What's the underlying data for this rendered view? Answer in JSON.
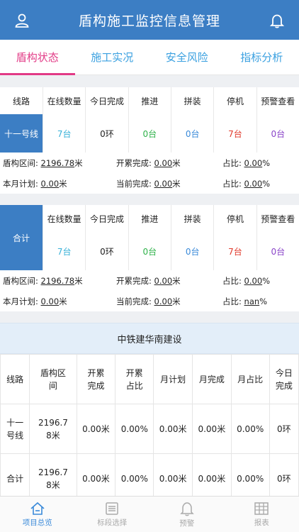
{
  "app": {
    "title": "盾构施工监控信息管理"
  },
  "icons": {
    "user": "user-icon",
    "bell": "bell-icon"
  },
  "tabs": [
    {
      "label": "盾构状态",
      "active": true
    },
    {
      "label": "施工实况",
      "active": false
    },
    {
      "label": "安全风险",
      "active": false
    },
    {
      "label": "指标分析",
      "active": false
    }
  ],
  "line_section": {
    "columns": [
      "线路",
      "在线数量",
      "今日完成",
      "推进",
      "拼装",
      "停机",
      "预警查看"
    ],
    "row_label": "十一号线",
    "values": [
      "7台",
      "0环",
      "0台",
      "0台",
      "7台",
      "0台"
    ],
    "info": {
      "interval_label": "盾构区间:",
      "interval_value": "2196.78",
      "interval_unit": "米",
      "cum_label": "开累完成:",
      "cum_value": "0.00",
      "cum_unit": "米",
      "ratio1_label": "占比:",
      "ratio1_value": "0.00",
      "ratio1_unit": "%",
      "plan_label": "本月计划:",
      "plan_value": "0.00",
      "plan_unit": "米",
      "cur_label": "当前完成:",
      "cur_value": "0.00",
      "cur_unit": "米",
      "ratio2_label": "占比:",
      "ratio2_value": "0.00",
      "ratio2_unit": "%"
    }
  },
  "total_section": {
    "row_label": "合计",
    "columns": [
      "在线数量",
      "今日完成",
      "推进",
      "拼装",
      "停机",
      "预警查看"
    ],
    "values": [
      "7台",
      "0环",
      "0台",
      "0台",
      "7台",
      "0台"
    ],
    "info": {
      "interval_label": "盾构区间:",
      "interval_value": "2196.78",
      "interval_unit": "米",
      "cum_label": "开累完成:",
      "cum_value": "0.00",
      "cum_unit": "米",
      "ratio1_label": "占比:",
      "ratio1_value": "0.00",
      "ratio1_unit": "%",
      "plan_label": "本月计划:",
      "plan_value": "0.00",
      "plan_unit": "米",
      "cur_label": "当前完成:",
      "cur_value": "0.00",
      "cur_unit": "米",
      "ratio2_label": "占比:",
      "ratio2_value": "nan",
      "ratio2_unit": "%"
    }
  },
  "company": {
    "name": "中铁建华南建设",
    "headers": [
      "线路",
      "盾构区间",
      "开累完成",
      "开累占比",
      "月计划",
      "月完成",
      "月占比",
      "今日完成"
    ],
    "rows": [
      [
        "十一号线",
        "2196.78米",
        "0.00米",
        "0.00%",
        "0.00米",
        "0.00米",
        "0.00%",
        "0环"
      ],
      [
        "合计",
        "2196.78米",
        "0.00米",
        "0.00%",
        "0.00米",
        "0.00米",
        "0.00%",
        "0环"
      ]
    ]
  },
  "bottom_nav": [
    {
      "label": "项目总览",
      "icon": "home-icon",
      "active": true
    },
    {
      "label": "标段选择",
      "icon": "list-icon",
      "active": false
    },
    {
      "label": "预警",
      "icon": "bell-icon",
      "active": false
    },
    {
      "label": "报表",
      "icon": "table-icon",
      "active": false
    }
  ],
  "colors": {
    "header": "#3c7ec4",
    "active_tab": "#e23a86",
    "tab": "#3aa0e0",
    "teal": "#38b1d8",
    "green": "#2fb24a",
    "blue": "#3a8ad9",
    "red": "#e0392b",
    "purple": "#8a44c8"
  }
}
